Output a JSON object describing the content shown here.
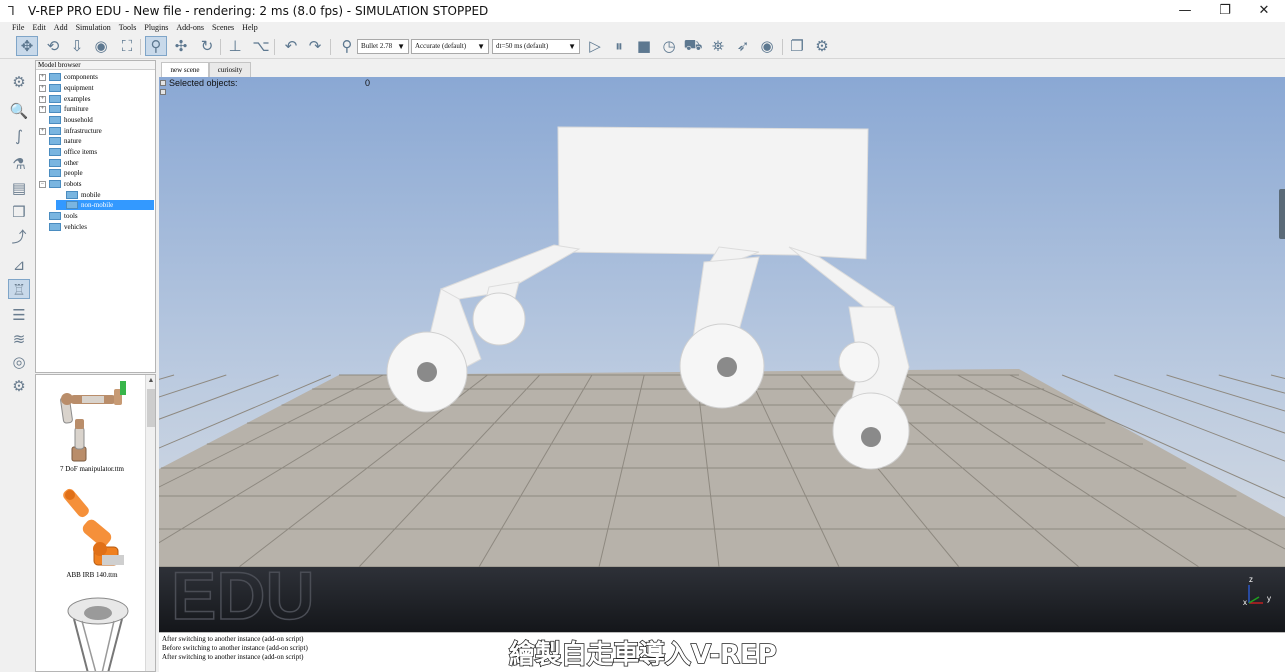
{
  "window": {
    "title": "V-REP PRO EDU - New file - rendering: 2 ms (8.0 fps) - SIMULATION STOPPED",
    "minimize": "—",
    "maximize": "❐",
    "close": "✕"
  },
  "menu": [
    "File",
    "Edit",
    "Add",
    "Simulation",
    "Tools",
    "Plugins",
    "Add-ons",
    "Scenes",
    "Help"
  ],
  "toolbar": {
    "physics_engine": "Bullet 2.78",
    "accuracy": "Accurate (default)",
    "timestep": "dt=50 ms (default)"
  },
  "model_browser": {
    "header": "Model browser",
    "items": [
      {
        "label": "components",
        "expandable": true
      },
      {
        "label": "equipment",
        "expandable": true
      },
      {
        "label": "examples",
        "expandable": true
      },
      {
        "label": "furniture",
        "expandable": true
      },
      {
        "label": "household",
        "expandable": false
      },
      {
        "label": "infrastructure",
        "expandable": true
      },
      {
        "label": "nature",
        "expandable": false
      },
      {
        "label": "office items",
        "expandable": false
      },
      {
        "label": "other",
        "expandable": false
      },
      {
        "label": "people",
        "expandable": false
      },
      {
        "label": "robots",
        "expandable": true
      },
      {
        "label": "mobile",
        "expandable": false
      },
      {
        "label": "non-mobile",
        "expandable": false,
        "selected": true
      },
      {
        "label": "tools",
        "expandable": false
      },
      {
        "label": "vehicles",
        "expandable": false
      }
    ]
  },
  "models": [
    {
      "label": "7 DoF manipulator.ttm"
    },
    {
      "label": "ABB IRB 140.ttm"
    },
    {
      "label": ""
    }
  ],
  "scene_tabs": [
    "new scene",
    "curiosity"
  ],
  "viewport": {
    "selected_label": "Selected objects:",
    "selected_count": "0",
    "watermark": "EDU",
    "axis_labels": {
      "z": "z",
      "x": "x",
      "y": "y"
    }
  },
  "console": [
    "After switching to another instance (add-on script)",
    "Before switching to another instance (add-on script)",
    "After switching to another instance (add-on script)"
  ],
  "subtitle": "繪製自走車導入V-REP",
  "colors": {
    "sky_top": "#8aa8d4",
    "sky_bottom": "#d9dde4",
    "floor_tile_light": "#c5c0b8",
    "floor_tile_dark": "#a59f97",
    "robot": "#f4f4f4",
    "selection": "#3399ff"
  }
}
